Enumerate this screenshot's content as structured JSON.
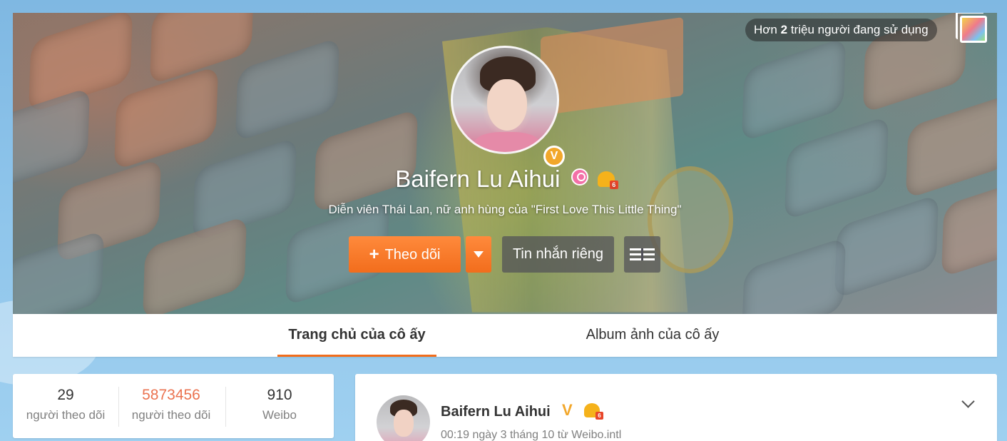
{
  "header": {
    "user_count_prefix": "Hơn",
    "user_count_value": "2",
    "user_count_suffix": "triệu người đang sử dụng"
  },
  "profile": {
    "name": "Baifern Lu Aihui",
    "description": "Diễn viên Thái Lan, nữ anh hùng của \"First Love This Little Thing\"",
    "verified_badge": "V",
    "follow_label": "Theo dõi",
    "message_label": "Tin nhắn riêng"
  },
  "tabs": [
    {
      "label": "Trang chủ của cô ấy",
      "active": true
    },
    {
      "label": "Album ảnh của cô ấy",
      "active": false
    }
  ],
  "stats": [
    {
      "value": "29",
      "label": "người theo dõi"
    },
    {
      "value": "5873456",
      "label": "người theo dõi"
    },
    {
      "value": "910",
      "label": "Weibo"
    }
  ],
  "feed": {
    "author": "Baifern Lu Aihui",
    "meta": "00:19 ngày 3 tháng 10 từ Weibo.intl"
  },
  "colors": {
    "accent": "#f26d1c",
    "highlight_number": "#eb7350",
    "verified": "#f2a72b"
  },
  "icons": [
    "skin-icon",
    "verified-icon",
    "female-icon",
    "crown-level-icon",
    "plus-icon",
    "dropdown-arrow-icon",
    "list-icon",
    "chevron-down-icon"
  ]
}
